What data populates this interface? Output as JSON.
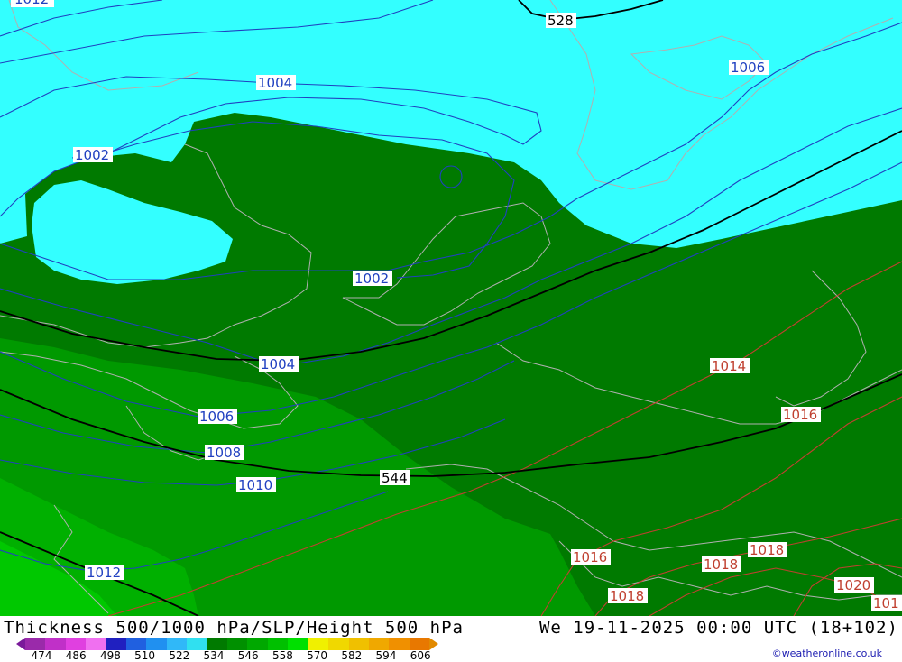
{
  "map": {
    "contour_labels": {
      "top_left_partial": "1012",
      "h528": "528",
      "p1006_ne": "1006",
      "p1004_n": "1004",
      "p1002_w": "1002",
      "p1002_c": "1002",
      "p1004_c": "1004",
      "p1006": "1006",
      "p1008": "1008",
      "p1010": "1010",
      "h544": "544",
      "p1012": "1012",
      "p1014": "1014",
      "p1016_e": "1016",
      "p1016_s": "1016",
      "p1018_a": "1018",
      "p1018_b": "1018",
      "p1018_c": "1018",
      "p1020": "1020",
      "p101_edge": "101"
    },
    "colors": {
      "cyan": "#33ffff",
      "green_dark": "#007a00",
      "green_mid": "#009900",
      "green_light": "#00b000",
      "green_bright": "#00c800",
      "isobar_blue": "#2040c0",
      "isobar_red": "#c04030",
      "height_black": "#000000",
      "coast_gray": "#b0b0b0"
    }
  },
  "footer": {
    "title": "Thickness 500/1000 hPa/SLP/Height 500 hPa",
    "datetime": "We 19-11-2025 00:00 UTC (18+102)",
    "credit": "©weatheronline.co.uk",
    "scale_ticks": [
      "474",
      "486",
      "498",
      "510",
      "522",
      "534",
      "546",
      "558",
      "570",
      "582",
      "594",
      "606"
    ],
    "scale_colors": [
      "#9a2aaa",
      "#c030c8",
      "#e040e0",
      "#f070f0",
      "#2020c0",
      "#2060e0",
      "#2090f0",
      "#30b8f8",
      "#30e0f0",
      "#007a00",
      "#009000",
      "#00a800",
      "#00c000",
      "#00e000",
      "#f0f000",
      "#f0d800",
      "#f0c000",
      "#f0a800",
      "#f09000",
      "#e87800"
    ]
  }
}
